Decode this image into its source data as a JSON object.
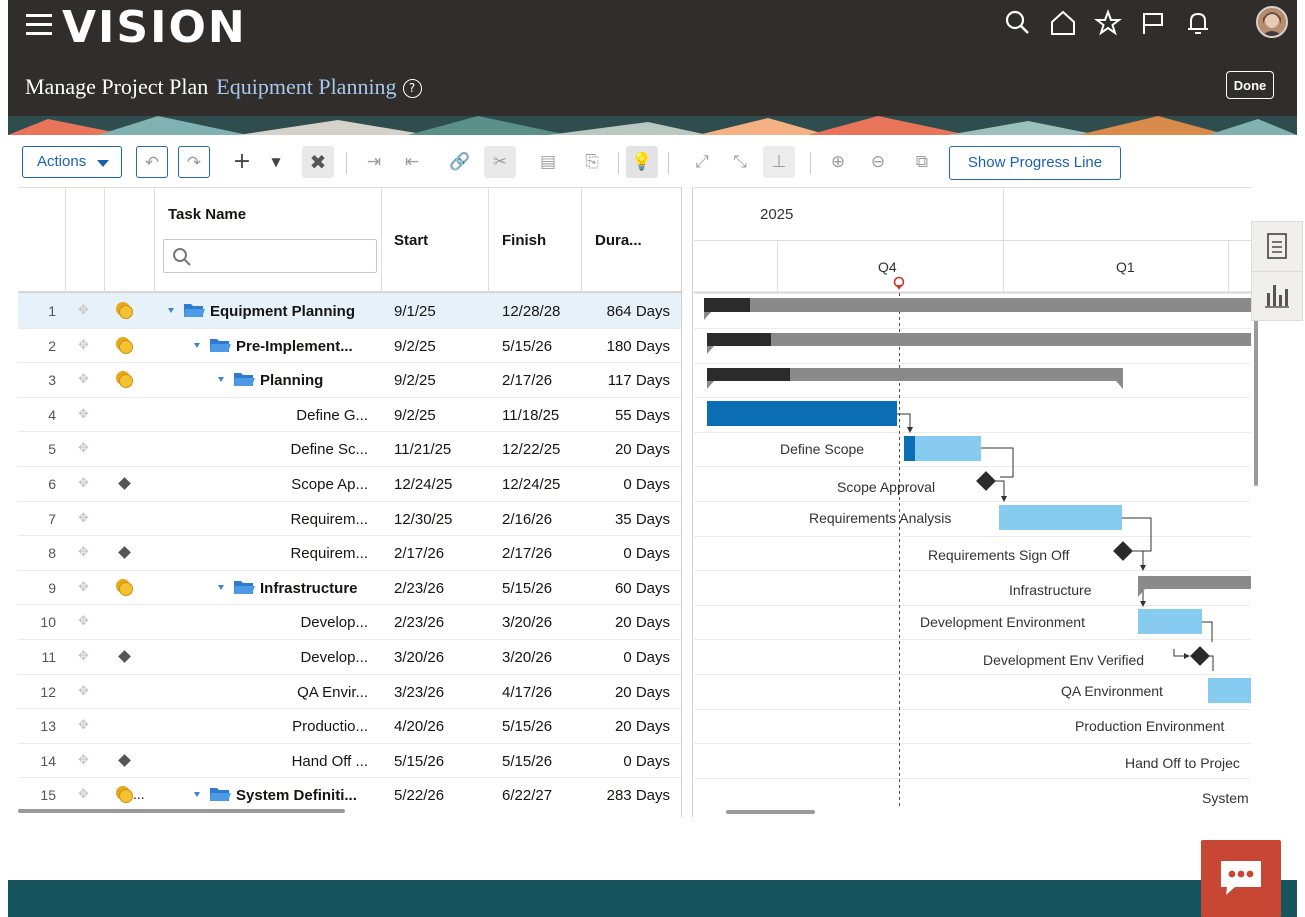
{
  "header": {
    "app_name": "VISION",
    "page_title": "Manage Project Plan",
    "project_name": "Equipment Planning",
    "done_label": "Done",
    "icons": [
      "menu-icon",
      "search-icon",
      "home-icon",
      "favorite-star-icon",
      "flag-icon",
      "notifications-bell-icon",
      "user-avatar"
    ]
  },
  "toolbar": {
    "actions_label": "Actions",
    "show_progress_line_label": "Show Progress Line",
    "icons": [
      "undo-icon",
      "redo-icon",
      "add-icon",
      "add-menu-caret-icon",
      "delete-icon",
      "indent-icon",
      "outdent-icon",
      "link-icon",
      "unlink-icon",
      "details-icon",
      "paste-icon",
      "lightbulb-icon",
      "expand-all-icon",
      "collapse-all-icon",
      "baseline-icon",
      "zoom-in-icon",
      "zoom-out-icon",
      "zoom-to-fit-icon"
    ]
  },
  "grid": {
    "columns": {
      "task_name": "Task Name",
      "start": "Start",
      "finish": "Finish",
      "duration": "Dura..."
    },
    "rows": [
      {
        "num": "1",
        "name": "Equipment Planning",
        "start": "9/1/25",
        "finish": "12/28/28",
        "dur": "864 Days",
        "type": "summary",
        "level": 0,
        "resource": true
      },
      {
        "num": "2",
        "name": "Pre-Implement...",
        "start": "9/2/25",
        "finish": "5/15/26",
        "dur": "180 Days",
        "type": "summary",
        "level": 1,
        "resource": true
      },
      {
        "num": "3",
        "name": "Planning",
        "start": "9/2/25",
        "finish": "2/17/26",
        "dur": "117 Days",
        "type": "summary",
        "level": 2,
        "resource": true
      },
      {
        "num": "4",
        "name": "Define G...",
        "start": "9/2/25",
        "finish": "11/18/25",
        "dur": "55 Days",
        "type": "task"
      },
      {
        "num": "5",
        "name": "Define Sc...",
        "start": "11/21/25",
        "finish": "12/22/25",
        "dur": "20 Days",
        "type": "task"
      },
      {
        "num": "6",
        "name": "Scope Ap...",
        "start": "12/24/25",
        "finish": "12/24/25",
        "dur": "0 Days",
        "type": "milestone"
      },
      {
        "num": "7",
        "name": "Requirem...",
        "start": "12/30/25",
        "finish": "2/16/26",
        "dur": "35 Days",
        "type": "task"
      },
      {
        "num": "8",
        "name": "Requirem...",
        "start": "2/17/26",
        "finish": "2/17/26",
        "dur": "0 Days",
        "type": "milestone"
      },
      {
        "num": "9",
        "name": "Infrastructure",
        "start": "2/23/26",
        "finish": "5/15/26",
        "dur": "60 Days",
        "type": "summary",
        "level": 2,
        "resource": true
      },
      {
        "num": "10",
        "name": "Develop...",
        "start": "2/23/26",
        "finish": "3/20/26",
        "dur": "20 Days",
        "type": "task"
      },
      {
        "num": "11",
        "name": "Develop...",
        "start": "3/20/26",
        "finish": "3/20/26",
        "dur": "0 Days",
        "type": "milestone"
      },
      {
        "num": "12",
        "name": "QA Envir...",
        "start": "3/23/26",
        "finish": "4/17/26",
        "dur": "20 Days",
        "type": "task"
      },
      {
        "num": "13",
        "name": "Productio...",
        "start": "4/20/26",
        "finish": "5/15/26",
        "dur": "20 Days",
        "type": "task"
      },
      {
        "num": "14",
        "name": "Hand Off ...",
        "start": "5/15/26",
        "finish": "5/15/26",
        "dur": "0 Days",
        "type": "milestone"
      },
      {
        "num": "15",
        "name": "System Definiti...",
        "start": "5/22/26",
        "finish": "6/22/27",
        "dur": "283 Days",
        "type": "summary",
        "level": 1,
        "resource": true,
        "resource_more": "..."
      }
    ]
  },
  "gantt": {
    "year": "2025",
    "quarters": [
      "Q4",
      "Q1"
    ],
    "labels": {
      "define_scope": "Define Scope",
      "scope_approval": "Scope Approval",
      "requirements_analysis": "Requirements Analysis",
      "requirements_sign_off": "Requirements Sign Off",
      "infrastructure": "Infrastructure",
      "development_environment": "Development Environment",
      "development_env_verified": "Development Env Verified",
      "qa_environment": "QA Environment",
      "production_environment": "Production Environment",
      "hand_off": "Hand Off to Projec",
      "system": "System"
    }
  },
  "colors": {
    "header_bg": "#312d2a",
    "accent": "#1a62b0",
    "bar_light": "#88cbf0",
    "bar_dark": "#0b6eb4",
    "summary": "#8a8a8a",
    "chat": "#c74634"
  }
}
